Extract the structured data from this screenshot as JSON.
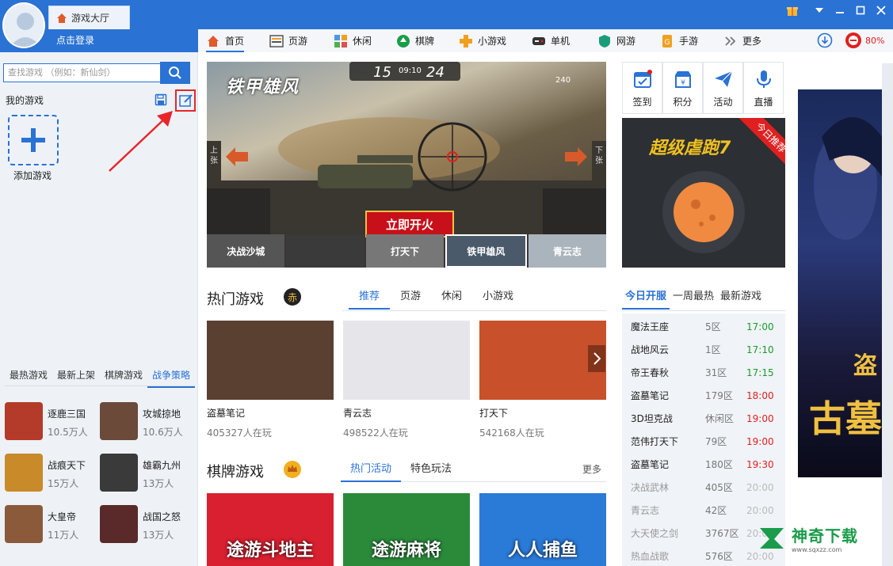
{
  "app": {
    "home_tab": "游戏大厅",
    "login_text": "点击登录",
    "battery_percent": "80%"
  },
  "nav": {
    "items": [
      "首页",
      "页游",
      "休闲",
      "棋牌",
      "小游戏",
      "单机",
      "网游",
      "手游",
      "更多"
    ],
    "active": "首页"
  },
  "search": {
    "placeholder": "查找游戏 （例如：新仙剑）"
  },
  "my_games": {
    "title": "我的游戏",
    "add_label": "添加游戏"
  },
  "left_tabs": {
    "items": [
      "最热游戏",
      "最新上架",
      "棋牌游戏",
      "战争策略"
    ],
    "active": "战争策略"
  },
  "left_games": [
    {
      "name": "逐鹿三国",
      "count": "10.5万人",
      "color": "#b43a2a"
    },
    {
      "name": "攻城掠地",
      "count": "10.6万人",
      "color": "#6b4a3a"
    },
    {
      "name": "战痕天下",
      "count": "15万人",
      "color": "#c98a2a"
    },
    {
      "name": "雄霸九州",
      "count": "13万人",
      "color": "#3a3a3a"
    },
    {
      "name": "大皇帝",
      "count": "11万人",
      "color": "#8a5a3a"
    },
    {
      "name": "战国之怒",
      "count": "13万人",
      "color": "#5a2a2a"
    }
  ],
  "banner": {
    "score_left": "15",
    "score_time": "09:10",
    "score_right": "24",
    "logo": "铁甲雄风",
    "cta": "立即开火",
    "ammo": "240",
    "prev_label": "上张",
    "next_label": "下张",
    "thumbs": [
      "决战沙城",
      "",
      "打天下",
      "铁甲雄风",
      "青云志"
    ]
  },
  "hot": {
    "title": "热门游戏",
    "badge": "赤",
    "tabs": [
      "推荐",
      "页游",
      "休闲",
      "小游戏"
    ],
    "active": "推荐",
    "cards": [
      {
        "title": "盗墓笔记",
        "players": "405327人在玩",
        "color": "#5a4030"
      },
      {
        "title": "青云志",
        "players": "498522人在玩",
        "color": "#e6e6ea"
      },
      {
        "title": "打天下",
        "players": "542168人在玩",
        "color": "#c8502a"
      }
    ]
  },
  "chess": {
    "title": "棋牌游戏",
    "tabs": [
      "热门活动",
      "特色玩法"
    ],
    "active": "热门活动",
    "more": "更多",
    "cards": [
      {
        "title": "途游斗地主",
        "color": "#d82030"
      },
      {
        "title": "途游麻将",
        "color": "#2a8a3a"
      },
      {
        "title": "人人捕鱼",
        "color": "#2a7ad8"
      }
    ]
  },
  "quick": [
    {
      "label": "签到",
      "icon": "calendar-icon"
    },
    {
      "label": "积分",
      "icon": "shop-icon"
    },
    {
      "label": "活动",
      "icon": "paper-plane-icon"
    },
    {
      "label": "直播",
      "icon": "microphone-icon"
    }
  ],
  "promo": {
    "title": "超级虐跑7",
    "ribbon": "今日推荐"
  },
  "server": {
    "tabs": [
      "今日开服",
      "一周最热",
      "最新游戏"
    ],
    "active": "今日开服",
    "rows": [
      {
        "name": "魔法王座",
        "zone": "5区",
        "time": "17:00",
        "status": "green"
      },
      {
        "name": "战地风云",
        "zone": "1区",
        "time": "17:10",
        "status": "green"
      },
      {
        "name": "帝王春秋",
        "zone": "31区",
        "time": "17:15",
        "status": "green"
      },
      {
        "name": "盗墓笔记",
        "zone": "179区",
        "time": "18:00",
        "status": "red"
      },
      {
        "name": "3D坦克战",
        "zone": "休闲区",
        "time": "19:00",
        "status": "red"
      },
      {
        "name": "范伟打天下",
        "zone": "79区",
        "time": "19:00",
        "status": "red"
      },
      {
        "name": "盗墓笔记",
        "zone": "180区",
        "time": "19:30",
        "status": "red"
      },
      {
        "name": "决战武林",
        "zone": "405区",
        "time": "20:00",
        "status": "gray"
      },
      {
        "name": "青云志",
        "zone": "42区",
        "time": "20:00",
        "status": "gray"
      },
      {
        "name": "大天使之剑",
        "zone": "3767区",
        "time": "20:00",
        "status": "gray"
      },
      {
        "name": "热血战歌",
        "zone": "576区",
        "time": "20:00",
        "status": "gray"
      }
    ]
  },
  "ad": {
    "text_top": "盗",
    "text_main": "古墓"
  },
  "watermark": {
    "brand": "神奇下载",
    "url": "www.sqxzz.com"
  },
  "colors": {
    "primary": "#2a72d4",
    "annotation_red": "#e8262a"
  }
}
